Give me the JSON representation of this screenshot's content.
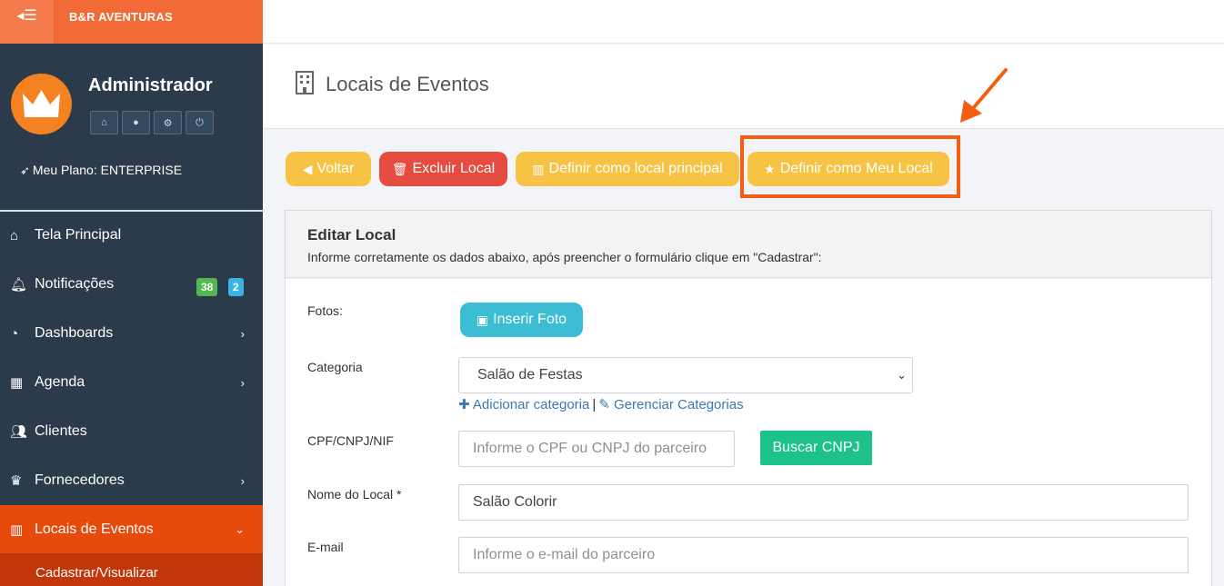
{
  "sidebar": {
    "brand": "B&R AVENTURAS",
    "toggle_icon": "menu-collapse-icon",
    "user_name": "Administrador",
    "plan_text": "Meu Plano: ENTERPRISE",
    "menu": [
      {
        "label": "Tela Principal",
        "icon": "home-icon"
      },
      {
        "label": "Notificações",
        "icon": "bell-icon",
        "badge_green": "38",
        "badge_blue": "2"
      },
      {
        "label": "Dashboards",
        "icon": "dashboard-icon",
        "chevron": "›"
      },
      {
        "label": "Agenda",
        "icon": "calendar-icon",
        "chevron": "›"
      },
      {
        "label": "Clientes",
        "icon": "users-icon"
      },
      {
        "label": "Fornecedores",
        "icon": "trophy-icon",
        "chevron": "›"
      },
      {
        "label": "Locais de Eventos",
        "icon": "building-icon",
        "chevron": "⌄"
      }
    ],
    "submenu_label": "Cadastrar/Visualizar",
    "colors": {
      "bg": "#2c3b4b",
      "accent": "#f26a35",
      "active": "#e84a0c"
    }
  },
  "header": {
    "page_title": "Locais de Eventos"
  },
  "actions": {
    "voltar": "Voltar",
    "excluir": "Excluir Local",
    "principal": "Definir como local principal",
    "meu_local": "Definir como Meu Local"
  },
  "card": {
    "title": "Editar Local",
    "subtitle": "Informe corretamente os dados abaixo, após preencher o formulário clique em \"Cadastrar\":"
  },
  "form": {
    "fotos_label": "Fotos:",
    "inserir_foto": "Inserir Foto",
    "categoria_label": "Categoria",
    "categoria_value": "Salão de Festas",
    "add_categoria": "Adicionar categoria",
    "link_sep": "|",
    "gerenciar": "Gerenciar Categorias",
    "cpf_label": "CPF/CNPJ/NIF",
    "cpf_placeholder": "Informe o CPF ou CNPJ do parceiro",
    "buscar_cnpj": "Buscar CNPJ",
    "nome_label": "Nome do Local *",
    "nome_value": "Salão Colorir",
    "email_label": "E-mail",
    "email_placeholder": "Informe o e-mail do parceiro"
  }
}
